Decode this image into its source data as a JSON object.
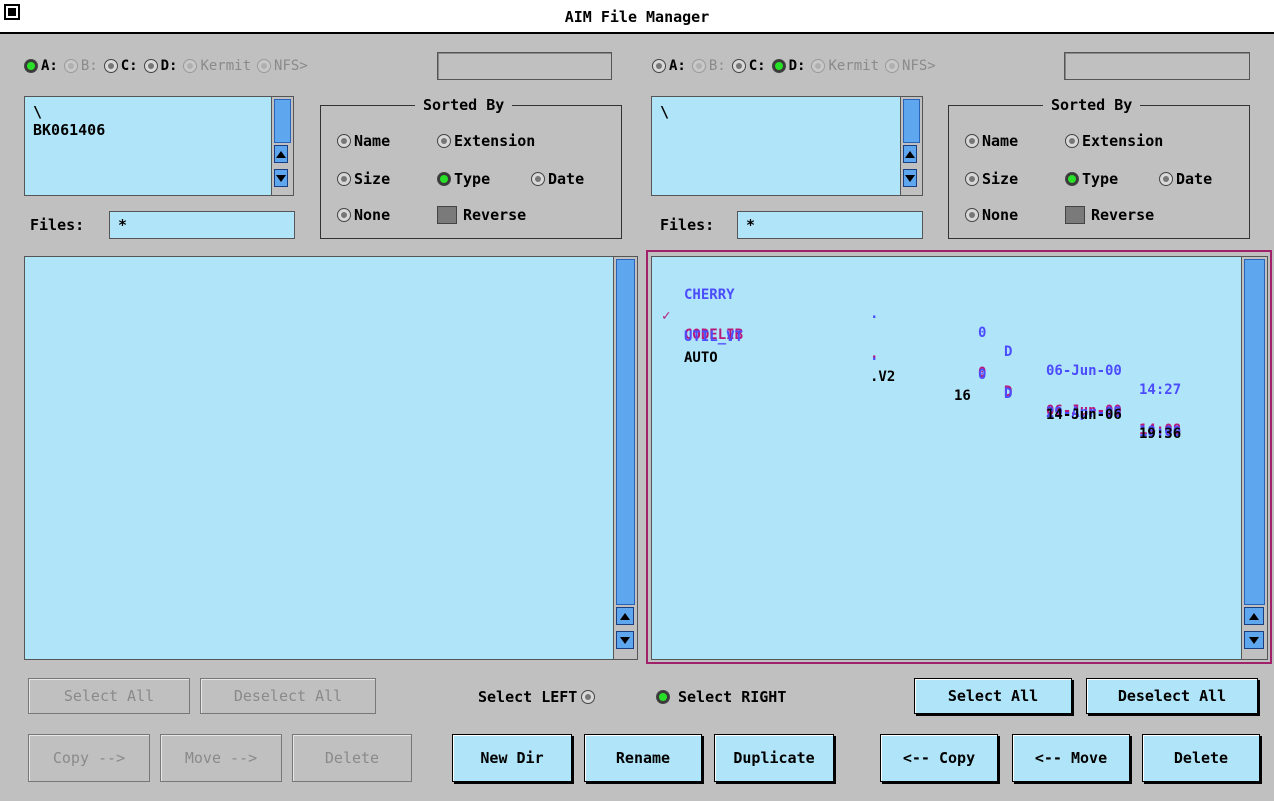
{
  "window": {
    "title": "AIM File Manager"
  },
  "left": {
    "drives": [
      {
        "label": "A:",
        "state": "on"
      },
      {
        "label": "B:",
        "state": "dim"
      },
      {
        "label": "C:",
        "state": "off"
      },
      {
        "label": "D:",
        "state": "off"
      },
      {
        "label": "Kermit",
        "state": "dim"
      },
      {
        "label": "NFS>",
        "state": "dim"
      }
    ],
    "dir_list": [
      "\\",
      "BK061406"
    ],
    "sorted_by": {
      "legend": "Sorted By",
      "options": {
        "name": "Name",
        "extension": "Extension",
        "size": "Size",
        "type": "Type",
        "date": "Date",
        "none": "None",
        "reverse": "Reverse"
      },
      "selected": "type"
    },
    "files_label": "Files:",
    "files_filter": "*",
    "select_all": "Select All",
    "deselect_all": "Deselect All",
    "copy": "Copy -->",
    "move": "Move -->",
    "delete": "Delete"
  },
  "right": {
    "drives": [
      {
        "label": "A:",
        "state": "off"
      },
      {
        "label": "B:",
        "state": "dim"
      },
      {
        "label": "C:",
        "state": "off"
      },
      {
        "label": "D:",
        "state": "on"
      },
      {
        "label": "Kermit",
        "state": "dim"
      },
      {
        "label": "NFS>",
        "state": "dim"
      }
    ],
    "dir_list": [
      "\\"
    ],
    "sorted_by": {
      "legend": "Sorted By",
      "options": {
        "name": "Name",
        "extension": "Extension",
        "size": "Size",
        "type": "Type",
        "date": "Date",
        "none": "None",
        "reverse": "Reverse"
      },
      "selected": "type"
    },
    "files_label": "Files:",
    "files_filter": "*",
    "files": [
      {
        "mark": "",
        "name": "CHERRY",
        "ext": ".",
        "size": "0",
        "attr": "D",
        "date": "06-Jun-00",
        "time": "14:27",
        "color": "blue"
      },
      {
        "mark": "✓",
        "name": "CODELIB",
        "ext": ".",
        "size": "0",
        "attr": "D",
        "date": "06-Jun-00",
        "time": "14:08",
        "color": "mag"
      },
      {
        "mark": "",
        "name": "UTIL_VT",
        "ext": ".",
        "size": "0",
        "attr": "D",
        "date": "29-Apr-05",
        "time": "18:00",
        "color": "blue"
      },
      {
        "mark": "",
        "name": "AUTO",
        "ext": ".V2",
        "size": "16",
        "attr": "",
        "date": "14-Jun-06",
        "time": "19:36",
        "color": "blk"
      }
    ],
    "select_all": "Select All",
    "deselect_all": "Deselect All",
    "copy": "<-- Copy",
    "move": "<-- Move",
    "delete": "Delete"
  },
  "center": {
    "select_left": "Select LEFT",
    "select_right": "Select RIGHT",
    "selected_side": "right",
    "new_dir": "New Dir",
    "rename": "Rename",
    "duplicate": "Duplicate"
  },
  "colors": {
    "panel_bg": "#b0e4f8",
    "window_bg": "#c0c0c0",
    "scrollbar": "#5ea6ee",
    "selection_frame": "#a0206a",
    "dir_entry": "#4c4cff",
    "checked_entry": "#b8187a"
  }
}
